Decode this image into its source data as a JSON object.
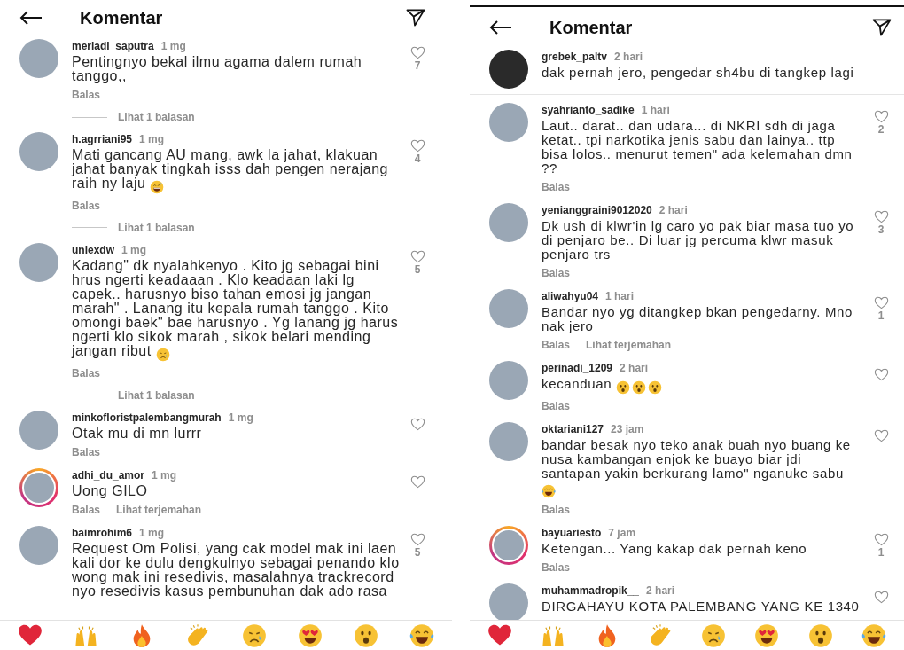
{
  "panels": [
    {
      "title": "Komentar",
      "top_rule": false,
      "comments": [
        {
          "kind": "comment",
          "username": "meriadi_saputra",
          "time": "1 mg",
          "text": "Pentingnyo bekal ilmu agama dalem rumah tanggo,,",
          "likes": "7",
          "story_ring": false,
          "actions": [
            "Balas"
          ],
          "view_replies": "Lihat 1 balasan"
        },
        {
          "kind": "comment",
          "username": "h.agrriani95",
          "time": "1 mg",
          "text": "Mati gancang AU mang, awk la jahat, klakuan jahat banyak tingkah isss dah pengen nerajang raih ny laju",
          "emojis": [
            {
              "kind": "grin_sweat"
            }
          ],
          "likes": "4",
          "story_ring": false,
          "actions": [
            "Balas"
          ],
          "view_replies": "Lihat 1 balasan"
        },
        {
          "kind": "comment",
          "username": "uniexdw",
          "time": "1 mg",
          "text": "Kadang\" dk nyalahkenyo . Kito jg sebagai bini hrus ngerti keadaaan . Klo keadaan laki lg capek.. harusnyo biso tahan emosi jg jangan marah\" . Lanang itu kepala rumah tanggo . Kito omongi baek\" bae harusnyo . Yg lanang jg harus ngerti klo sikok marah , sikok belari mending jangan ribut",
          "emojis": [
            {
              "kind": "cry"
            }
          ],
          "likes": "5",
          "story_ring": false,
          "actions": [
            "Balas"
          ],
          "view_replies": "Lihat 1 balasan"
        },
        {
          "kind": "comment",
          "username": "minkofloristpalembangmurah",
          "time": "1 mg",
          "text": "Otak mu di mn lurrr",
          "story_ring": false,
          "actions": [
            "Balas"
          ]
        },
        {
          "kind": "comment",
          "username": "adhi_du_amor",
          "time": "1 mg",
          "text": "Uong GILO",
          "story_ring": true,
          "actions": [
            "Balas",
            "Lihat terjemahan"
          ]
        },
        {
          "kind": "comment",
          "username": "baimrohim6",
          "time": "1 mg",
          "text": "Request Om Polisi, yang cak model mak ini laen kali dor ke dulu dengkulnyo sebagai penando klo wong mak ini resedivis, masalahnya trackrecord nyo resedivis kasus pembunuhan dak ado rasa",
          "likes": "5",
          "story_ring": false
        }
      ],
      "emoji_bar": [
        {
          "kind": "heart"
        },
        {
          "kind": "raised_hands"
        },
        {
          "kind": "fire"
        },
        {
          "kind": "clap"
        },
        {
          "kind": "cry"
        },
        {
          "kind": "heart_eyes"
        },
        {
          "kind": "surprised"
        },
        {
          "kind": "joy"
        }
      ]
    },
    {
      "title": "Komentar",
      "top_rule": true,
      "comments": [
        {
          "kind": "caption",
          "username": "grebek_paltv",
          "time": "2 hari",
          "text": "dak pernah jero, pengedar sh4bu di tangkep lagi",
          "story_ring": false
        },
        {
          "kind": "comment",
          "username": "syahrianto_sadike",
          "time": "1 hari",
          "text": "Laut.. darat.. dan  udara... di NKRI sdh di jaga ketat.. tpi narkotika jenis sabu dan lainya.. ttp bisa lolos.. menurut temen\" ada kelemahan dmn ??",
          "likes": "2",
          "story_ring": false,
          "actions": [
            "Balas"
          ]
        },
        {
          "kind": "comment",
          "username": "yenianggraini9012020",
          "time": "2 hari",
          "text": "Dk ush di klwr'in lg caro yo pak biar masa tuo yo di penjaro be.. Di luar jg percuma klwr masuk penjaro trs",
          "likes": "3",
          "story_ring": false,
          "actions": [
            "Balas"
          ]
        },
        {
          "kind": "comment",
          "username": "aliwahyu04",
          "time": "1 hari",
          "text": "Bandar nyo yg ditangkep bkan pengedarny. Mno nak jero",
          "likes": "1",
          "story_ring": false,
          "actions": [
            "Balas",
            "Lihat terjemahan"
          ]
        },
        {
          "kind": "comment",
          "username": "perinadi_1209",
          "time": "2 hari",
          "text": "kecanduan",
          "emojis": [
            {
              "kind": "surprised"
            },
            {
              "kind": "surprised"
            },
            {
              "kind": "surprised"
            }
          ],
          "story_ring": false,
          "actions": [
            "Balas"
          ]
        },
        {
          "kind": "comment",
          "username": "oktariani127",
          "time": "23 jam",
          "text": "bandar besak nyo teko anak buah nyo buang ke nusa kambangan enjok ke buayo biar jdi santapan yakin berkurang lamo\" nganuke sabu",
          "emojis": [
            {
              "kind": "joy"
            }
          ],
          "story_ring": false,
          "actions": [
            "Balas"
          ]
        },
        {
          "kind": "comment",
          "username": "bayuariesto",
          "time": "7 jam",
          "text": "Ketengan... Yang kakap dak pernah keno",
          "likes": "1",
          "story_ring": true,
          "actions": [
            "Balas"
          ]
        },
        {
          "kind": "comment",
          "username": "muhammadropik__",
          "time": "2 hari",
          "text": "DIRGAHAYU KOTA PALEMBANG YANG KE 1340",
          "story_ring": false
        }
      ],
      "emoji_bar": [
        {
          "kind": "heart"
        },
        {
          "kind": "raised_hands"
        },
        {
          "kind": "fire"
        },
        {
          "kind": "clap"
        },
        {
          "kind": "cry"
        },
        {
          "kind": "heart_eyes"
        },
        {
          "kind": "surprised"
        },
        {
          "kind": "joy"
        }
      ]
    }
  ]
}
